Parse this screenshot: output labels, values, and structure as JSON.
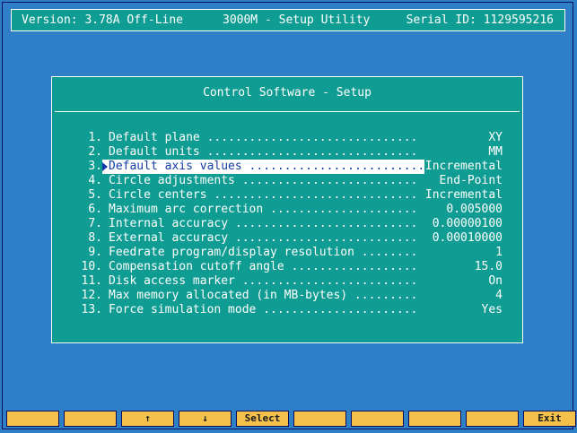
{
  "header": {
    "version": "Version: 3.78A Off-Line",
    "title": "3000M - Setup Utility",
    "serial": "Serial ID: 1129595216"
  },
  "dialog": {
    "title": "Control Software - Setup",
    "options": [
      {
        "num": "1.",
        "label": "Default plane",
        "value": "XY"
      },
      {
        "num": "2.",
        "label": "Default units",
        "value": "MM"
      },
      {
        "num": "3.",
        "label": "Default axis values",
        "value": "Incremental",
        "selected": true
      },
      {
        "num": "4.",
        "label": "Circle adjustments",
        "value": "End-Point"
      },
      {
        "num": "5.",
        "label": "Circle centers",
        "value": "Incremental"
      },
      {
        "num": "6.",
        "label": "Maximum arc correction",
        "value": "0.005000"
      },
      {
        "num": "7.",
        "label": "Internal accuracy",
        "value": "0.00000100"
      },
      {
        "num": "8.",
        "label": "External accuracy",
        "value": "0.00010000"
      },
      {
        "num": "9.",
        "label": "Feedrate program/display resolution",
        "value": "1"
      },
      {
        "num": "10.",
        "label": "Compensation cutoff angle",
        "value": "15.0"
      },
      {
        "num": "11.",
        "label": "Disk access marker",
        "value": "On"
      },
      {
        "num": "12.",
        "label": "Max memory allocated (in MB-bytes)",
        "value": "4"
      },
      {
        "num": "13.",
        "label": "Force simulation mode",
        "value": "Yes"
      }
    ]
  },
  "function_keys": [
    {
      "label": ""
    },
    {
      "label": ""
    },
    {
      "label": "↑"
    },
    {
      "label": "↓"
    },
    {
      "label": "Select"
    },
    {
      "label": ""
    },
    {
      "label": ""
    },
    {
      "label": ""
    },
    {
      "label": ""
    },
    {
      "label": "Exit"
    }
  ],
  "colors": {
    "background": "#2f7fc8",
    "panel": "#0f9c92",
    "text": "#ffffff",
    "selection_text": "#123caa",
    "function_key": "#f5c14a"
  }
}
